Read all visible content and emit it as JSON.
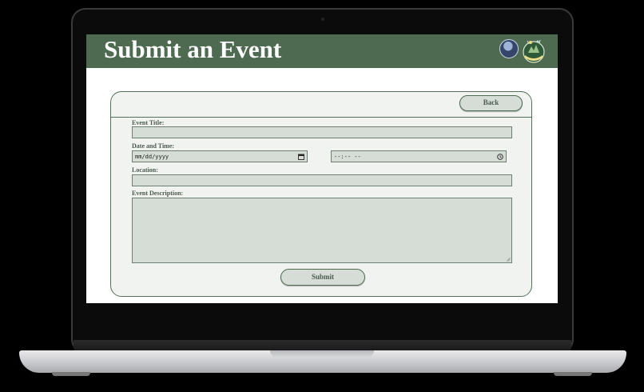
{
  "header": {
    "title": "Submit an Event"
  },
  "nav": {
    "back_label": "Back"
  },
  "form": {
    "title_label": "Event Title:",
    "datetime_label": "Date and Time:",
    "date_placeholder": "mm/dd/yyyy",
    "time_placeholder": "--:-- --",
    "location_label": "Location:",
    "description_label": "Event Description:",
    "submit_label": "Submit"
  },
  "colors": {
    "header_bg": "#4e6b52",
    "field_bg": "#d5ddd6",
    "card_bg": "#f1f3f1",
    "border": "#55705a"
  },
  "icons": [
    "avatar",
    "logo-icon",
    "calendar-icon",
    "clock-icon",
    "resize-grip-icon"
  ]
}
